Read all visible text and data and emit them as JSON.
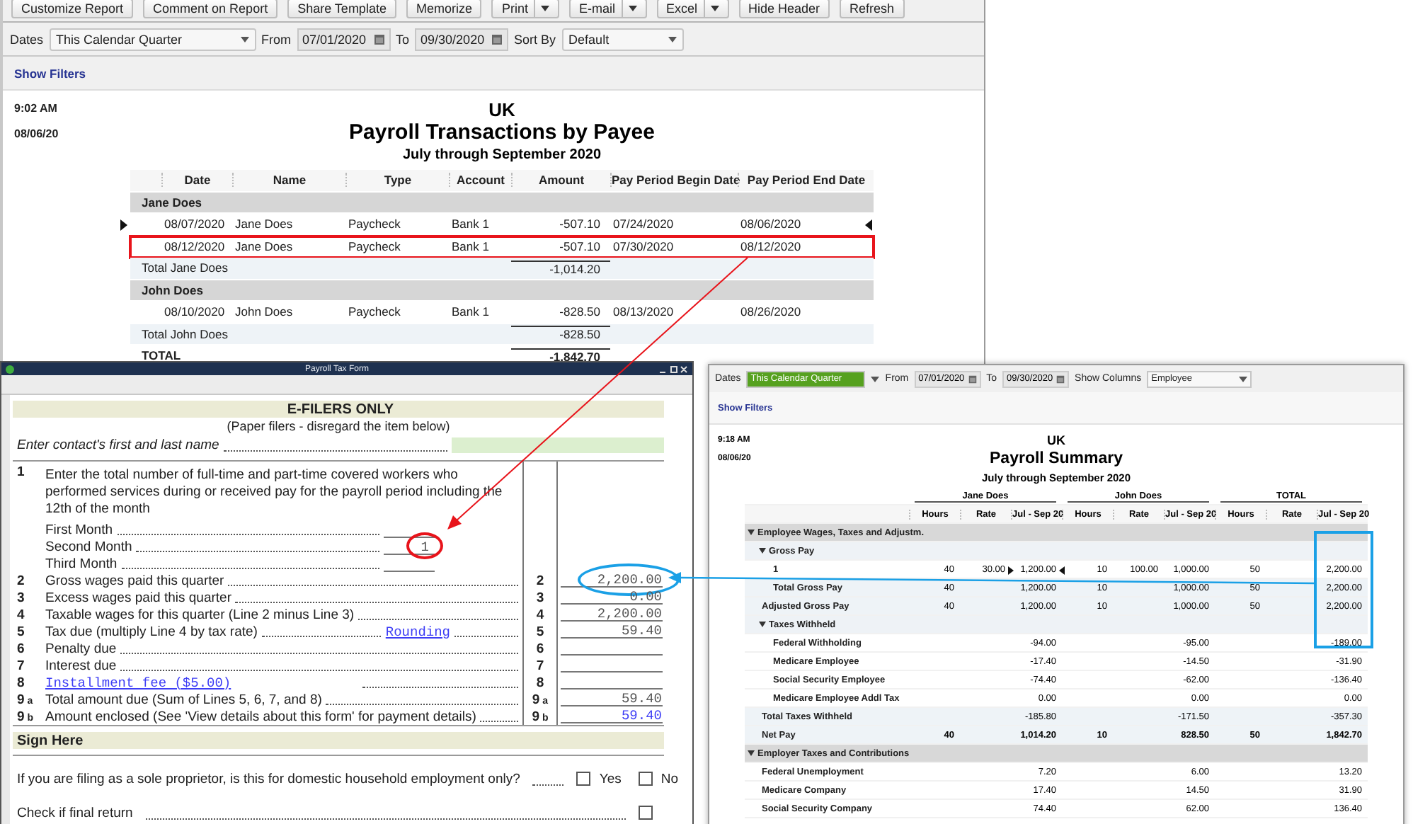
{
  "report_window": {
    "toolbar": [
      {
        "label": "Customize Report",
        "dropdown": false
      },
      {
        "label": "Comment on Report",
        "dropdown": false
      },
      {
        "label": "Share Template",
        "dropdown": false
      },
      {
        "label": "Memorize",
        "dropdown": false
      },
      {
        "label": "Print",
        "dropdown": true
      },
      {
        "label": "E-mail",
        "dropdown": true
      },
      {
        "label": "Excel",
        "dropdown": true
      },
      {
        "label": "Hide Header",
        "dropdown": false
      },
      {
        "label": "Refresh",
        "dropdown": false
      }
    ],
    "filters": {
      "dates_label": "Dates",
      "dates_value": "This Calendar Quarter",
      "from_label": "From",
      "from_value": "07/01/2020",
      "to_label": "To",
      "to_value": "09/30/2020",
      "sort_label": "Sort By",
      "sort_value": "Default"
    },
    "show_filters": "Show Filters",
    "time": "9:02 AM",
    "date": "08/06/20",
    "company": "UK",
    "title": "Payroll Transactions by Payee",
    "period": "July through September 2020",
    "columns": [
      "Date",
      "Name",
      "Type",
      "Account",
      "Amount",
      "Pay Period Begin Date",
      "Pay Period End Date"
    ],
    "rows": [
      {
        "kind": "group",
        "label": "Jane Does"
      },
      {
        "kind": "row",
        "cells": [
          "08/07/2020",
          "Jane Does",
          "Paycheck",
          "Bank 1",
          "-507.10",
          "07/24/2020",
          "08/06/2020"
        ],
        "current": true,
        "annotated": false
      },
      {
        "kind": "row",
        "cells": [
          "08/12/2020",
          "Jane Does",
          "Paycheck",
          "Bank 1",
          "-507.10",
          "07/30/2020",
          "08/12/2020"
        ],
        "current": false,
        "annotated": true
      },
      {
        "kind": "total",
        "label": "Total Jane Does",
        "amount": "-1,014.20"
      },
      {
        "kind": "group",
        "label": "John Does"
      },
      {
        "kind": "row",
        "cells": [
          "08/10/2020",
          "John Does",
          "Paycheck",
          "Bank 1",
          "-828.50",
          "08/13/2020",
          "08/26/2020"
        ],
        "current": false,
        "annotated": false
      },
      {
        "kind": "total",
        "label": "Total John Does",
        "amount": "-828.50"
      },
      {
        "kind": "grand_total",
        "label": "TOTAL",
        "amount": "-1,842.70"
      }
    ]
  },
  "tax_form": {
    "title": "Payroll Tax Form",
    "section_title": "E-FILERS ONLY",
    "note": "(Paper filers - disregard the item below)",
    "contact_label": "Enter contact's first and last name",
    "line1": {
      "number": "1",
      "text": "Enter the total number of full-time and part-time covered workers who performed services during or received pay for the payroll period including the 12th of the month",
      "months": [
        {
          "label": "First Month",
          "circled": false
        },
        {
          "label": "Second Month",
          "value": "1",
          "circled": true
        },
        {
          "label": "Third Month",
          "circled": false
        }
      ]
    },
    "lines": [
      {
        "kind": "text",
        "number": "2",
        "text": "Gross wages paid this quarter",
        "ref": "2",
        "value": "2,200.00",
        "circled": true
      },
      {
        "kind": "text",
        "number": "3",
        "text": "Excess wages paid this quarter",
        "ref": "3",
        "value": "0.00",
        "circled": false
      },
      {
        "kind": "text",
        "number": "4",
        "text": "Taxable wages for this quarter (Line 2 minus Line 3)",
        "ref": "4",
        "value": "2,200.00",
        "circled": false
      },
      {
        "kind": "text",
        "number": "5",
        "text": "Tax due (multiply Line 4 by tax rate)",
        "link": "Rounding",
        "ref": "5",
        "value": "59.40",
        "circled": false
      },
      {
        "kind": "text",
        "number": "6",
        "text": "Penalty due",
        "ref": "6",
        "circled": false
      },
      {
        "kind": "text",
        "number": "7",
        "text": "Interest due",
        "ref": "7",
        "circled": false
      },
      {
        "kind": "link",
        "number": "8",
        "text": "Installment fee ($5.00)",
        "ref": "8",
        "circled": false
      },
      {
        "kind": "text",
        "number": "9",
        "sub": "a",
        "text": "Total amount due (Sum of Lines 5, 6, 7, and 8)",
        "ref": "9",
        "ref_sub": "a",
        "value": "59.40",
        "circled": false
      },
      {
        "kind": "text",
        "number": "9",
        "sub": "b",
        "text": "Amount enclosed  (See 'View details about this form' for payment details)",
        "ref": "9",
        "ref_sub": "b",
        "value": "59.40",
        "value_link": true,
        "circled": false
      }
    ],
    "sign_title": "Sign Here",
    "question": "If you are filing as a sole proprietor, is this for domestic household employment only?",
    "options": [
      {
        "label": "Yes",
        "checked": false
      },
      {
        "label": "No",
        "checked": false
      }
    ],
    "final_return": {
      "label": "Check if final return",
      "checked": false
    }
  },
  "summary_window": {
    "filters": {
      "dates_label": "Dates",
      "dates_value": "This Calendar Quarter",
      "dates_selected": true,
      "from_label": "From",
      "from_value": "07/01/2020",
      "to_label": "To",
      "to_value": "09/30/2020",
      "columns_label": "Show Columns",
      "columns_value": "Employee"
    },
    "show_filters": "Show Filters",
    "time": "9:18 AM",
    "date": "08/06/20",
    "company": "UK",
    "title": "Payroll Summary",
    "period": "July through September 2020",
    "groups": [
      "Jane Does",
      "John Does",
      "TOTAL"
    ],
    "columns": [
      "Hours",
      "Rate",
      "Jul - Sep 20",
      "Hours",
      "Rate",
      "Jul - Sep 20",
      "Hours",
      "Rate",
      "Jul - Sep 20"
    ],
    "rows": [
      {
        "kind": "section",
        "label": "Employee Wages, Taxes and Adjustm.",
        "expanded": true
      },
      {
        "kind": "subsection",
        "label": "Gross Pay",
        "expanded": true
      },
      {
        "kind": "detail",
        "label": "1",
        "current": true,
        "cells": [
          "40",
          "30.00",
          "1,200.00",
          "10",
          "100.00",
          "1,000.00",
          "50",
          null,
          "2,200.00"
        ]
      },
      {
        "kind": "subtotal",
        "label": "Total Gross Pay",
        "cells": [
          "40",
          null,
          "1,200.00",
          "10",
          null,
          "1,000.00",
          "50",
          null,
          "2,200.00"
        ]
      },
      {
        "kind": "total",
        "label": "Adjusted Gross Pay",
        "cells": [
          "40",
          null,
          "1,200.00",
          "10",
          null,
          "1,000.00",
          "50",
          null,
          "2,200.00"
        ]
      },
      {
        "kind": "subsection",
        "label": "Taxes Withheld",
        "expanded": true
      },
      {
        "kind": "detail",
        "label": "Federal Withholding",
        "cells": [
          null,
          null,
          "-94.00",
          null,
          null,
          "-95.00",
          null,
          null,
          "-189.00"
        ]
      },
      {
        "kind": "detail",
        "label": "Medicare Employee",
        "cells": [
          null,
          null,
          "-17.40",
          null,
          null,
          "-14.50",
          null,
          null,
          "-31.90"
        ]
      },
      {
        "kind": "detail",
        "label": "Social Security Employee",
        "cells": [
          null,
          null,
          "-74.40",
          null,
          null,
          "-62.00",
          null,
          null,
          "-136.40"
        ]
      },
      {
        "kind": "detail",
        "label": "Medicare Employee Addl Tax",
        "cells": [
          null,
          null,
          "0.00",
          null,
          null,
          "0.00",
          null,
          null,
          "0.00"
        ]
      },
      {
        "kind": "total",
        "label": "Total Taxes Withheld",
        "cells": [
          null,
          null,
          "-185.80",
          null,
          null,
          "-171.50",
          null,
          null,
          "-357.30"
        ]
      },
      {
        "kind": "net",
        "label": "Net Pay",
        "cells": [
          "40",
          null,
          "1,014.20",
          "10",
          null,
          "828.50",
          "50",
          null,
          "1,842.70"
        ]
      },
      {
        "kind": "section",
        "label": "Employer Taxes and Contributions",
        "expanded": true
      },
      {
        "kind": "item",
        "label": "Federal Unemployment",
        "cells": [
          null,
          null,
          "7.20",
          null,
          null,
          "6.00",
          null,
          null,
          "13.20"
        ]
      },
      {
        "kind": "item",
        "label": "Medicare Company",
        "cells": [
          null,
          null,
          "17.40",
          null,
          null,
          "14.50",
          null,
          null,
          "31.90"
        ]
      },
      {
        "kind": "item",
        "label": "Social Security Company",
        "cells": [
          null,
          null,
          "74.40",
          null,
          null,
          "62.00",
          null,
          null,
          "136.40"
        ]
      }
    ]
  }
}
